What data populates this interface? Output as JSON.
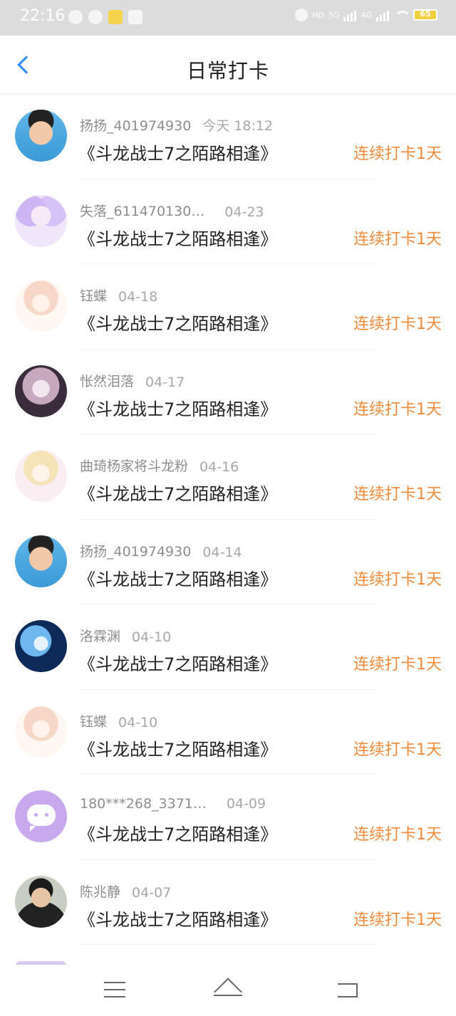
{
  "status_bar": {
    "time": "22:16",
    "hd": "HD",
    "net5g": "5G",
    "net4g": "4G",
    "battery": "65"
  },
  "header": {
    "title": "日常打卡"
  },
  "icons": {
    "back": "chevron-left-icon",
    "menu": "menu-icon",
    "home": "home-icon",
    "return": "return-icon"
  },
  "colors": {
    "accent_blue": "#2b8cf0",
    "streak_orange": "#ef8a3b",
    "status_bar_bg": "#dcdcdc"
  },
  "checkins": [
    {
      "user": "扬扬_401974930",
      "date": "今天  18:12",
      "book": "《斗龙战士7之陌路相逢》",
      "streak": "连续打卡1天"
    },
    {
      "user": "失落_611470130…",
      "date": "04-23",
      "book": "《斗龙战士7之陌路相逢》",
      "streak": "连续打卡1天"
    },
    {
      "user": "钰蝶",
      "date": "04-18",
      "book": "《斗龙战士7之陌路相逢》",
      "streak": "连续打卡1天"
    },
    {
      "user": "怅然泪落",
      "date": "04-17",
      "book": "《斗龙战士7之陌路相逢》",
      "streak": "连续打卡1天"
    },
    {
      "user": "曲琦杨家将斗龙粉",
      "date": "04-16",
      "book": "《斗龙战士7之陌路相逢》",
      "streak": "连续打卡1天"
    },
    {
      "user": "扬扬_401974930",
      "date": "04-14",
      "book": "《斗龙战士7之陌路相逢》",
      "streak": "连续打卡1天"
    },
    {
      "user": "洛霖渊",
      "date": "04-10",
      "book": "《斗龙战士7之陌路相逢》",
      "streak": "连续打卡1天"
    },
    {
      "user": "钰蝶",
      "date": "04-10",
      "book": "《斗龙战士7之陌路相逢》",
      "streak": "连续打卡1天"
    },
    {
      "user": "180***268_3371…",
      "date": "04-09",
      "book": "《斗龙战士7之陌路相逢》",
      "streak": "连续打卡1天"
    },
    {
      "user": "陈兆静",
      "date": "04-07",
      "book": "《斗龙战士7之陌路相逢》",
      "streak": "连续打卡1天"
    }
  ]
}
